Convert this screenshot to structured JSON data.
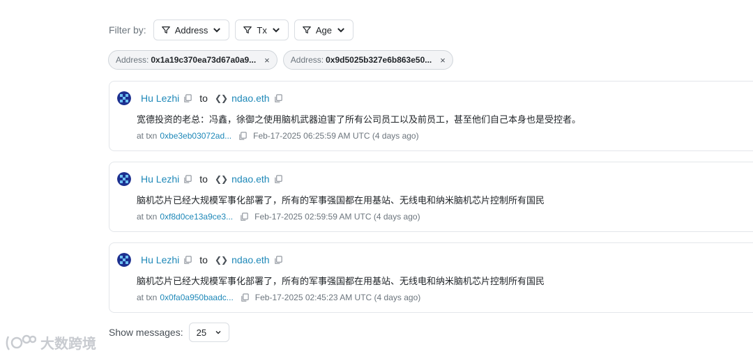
{
  "filter": {
    "label": "Filter by:",
    "buttons": [
      {
        "label": "Address"
      },
      {
        "label": "Tx"
      },
      {
        "label": "Age"
      }
    ]
  },
  "chips": [
    {
      "key": "Address:",
      "value": "0x1a19c370ea73d67a0a9...",
      "remove": "×"
    },
    {
      "key": "Address:",
      "value": "0x9d5025b327e6b863e50...",
      "remove": "×"
    }
  ],
  "messages": [
    {
      "from": "Hu Lezhi",
      "to_word": "to",
      "to": "ndao.eth",
      "text": "宽德投资的老总：冯鑫，徐御之使用脑机武器迫害了所有公司员工以及前员工，甚至他们自己本身也是受控者。",
      "at_txn": "at txn",
      "txn": "0xbe3eb03072ad...",
      "time": "Feb-17-2025 06:25:59 AM UTC (4 days ago)"
    },
    {
      "from": "Hu Lezhi",
      "to_word": "to",
      "to": "ndao.eth",
      "text": "脑机芯片已经大规模军事化部署了，所有的军事强国都在用基站、无线电和纳米脑机芯片控制所有国民",
      "at_txn": "at txn",
      "txn": "0xf8d0ce13a9ce3...",
      "time": "Feb-17-2025 02:59:59 AM UTC (4 days ago)"
    },
    {
      "from": "Hu Lezhi",
      "to_word": "to",
      "to": "ndao.eth",
      "text": "脑机芯片已经大规模军事化部署了，所有的军事强国都在用基站、无线电和纳米脑机芯片控制所有国民",
      "at_txn": "at txn",
      "txn": "0x0fa0a950baadc...",
      "time": "Feb-17-2025 02:45:23 AM UTC (4 days ago)"
    }
  ],
  "show": {
    "label": "Show messages:",
    "value": "25"
  },
  "watermark": {
    "text": "大数跨境"
  }
}
